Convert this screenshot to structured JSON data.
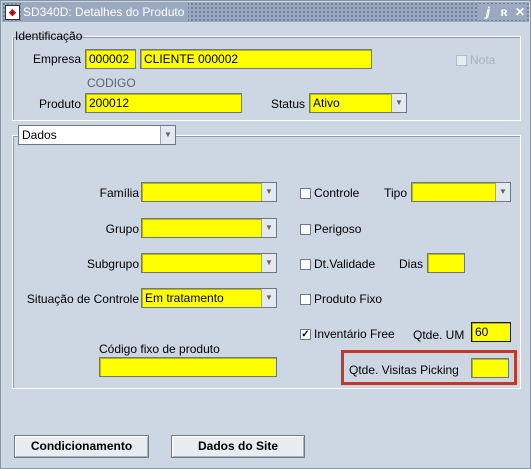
{
  "window": {
    "title": "SD340D: Detalhes do Produto",
    "app_icon": "oracle-forms-icon",
    "controls": {
      "minimize": "ⅉ",
      "maximize": "ʀ",
      "close": "✕"
    }
  },
  "identificacao": {
    "legend": "Identificação",
    "empresa_label": "Empresa",
    "empresa_code": "000002",
    "empresa_name": "CLIENTE 000002",
    "nota_label": "Nota",
    "codigo_label": "CODIGO",
    "produto_label": "Produto",
    "produto_value": "200012",
    "status_label": "Status",
    "status_value": "Ativo"
  },
  "dados": {
    "section_select": "Dados",
    "familia_label": "Família",
    "familia_value": "",
    "grupo_label": "Grupo",
    "grupo_value": "",
    "subgrupo_label": "Subgrupo",
    "subgrupo_value": "",
    "situacao_label": "Situação de Controle",
    "situacao_value": "Em tratamento",
    "codigo_fixo_label": "Código fixo de produto",
    "codigo_fixo_value": "",
    "controle_label": "Controle",
    "tipo_label": "Tipo",
    "tipo_value": "",
    "perigoso_label": "Perigoso",
    "dt_validade_label": "Dt.Validade",
    "dias_label": "Dias",
    "dias_value": "",
    "produto_fixo_label": "Produto Fixo",
    "inventario_label": "Inventário Free",
    "inventario_checked": true,
    "qtde_um_label": "Qtde. UM",
    "qtde_um_value": "60",
    "qtde_visitas_label": "Qtde. Visitas Picking",
    "qtde_visitas_value": ""
  },
  "buttons": {
    "condicionamento": "Condicionamento",
    "dados_site": "Dados do Site"
  },
  "colors": {
    "field": "#ffff00",
    "window_bg": "#cdd7e3",
    "highlight": "#c0392b"
  }
}
